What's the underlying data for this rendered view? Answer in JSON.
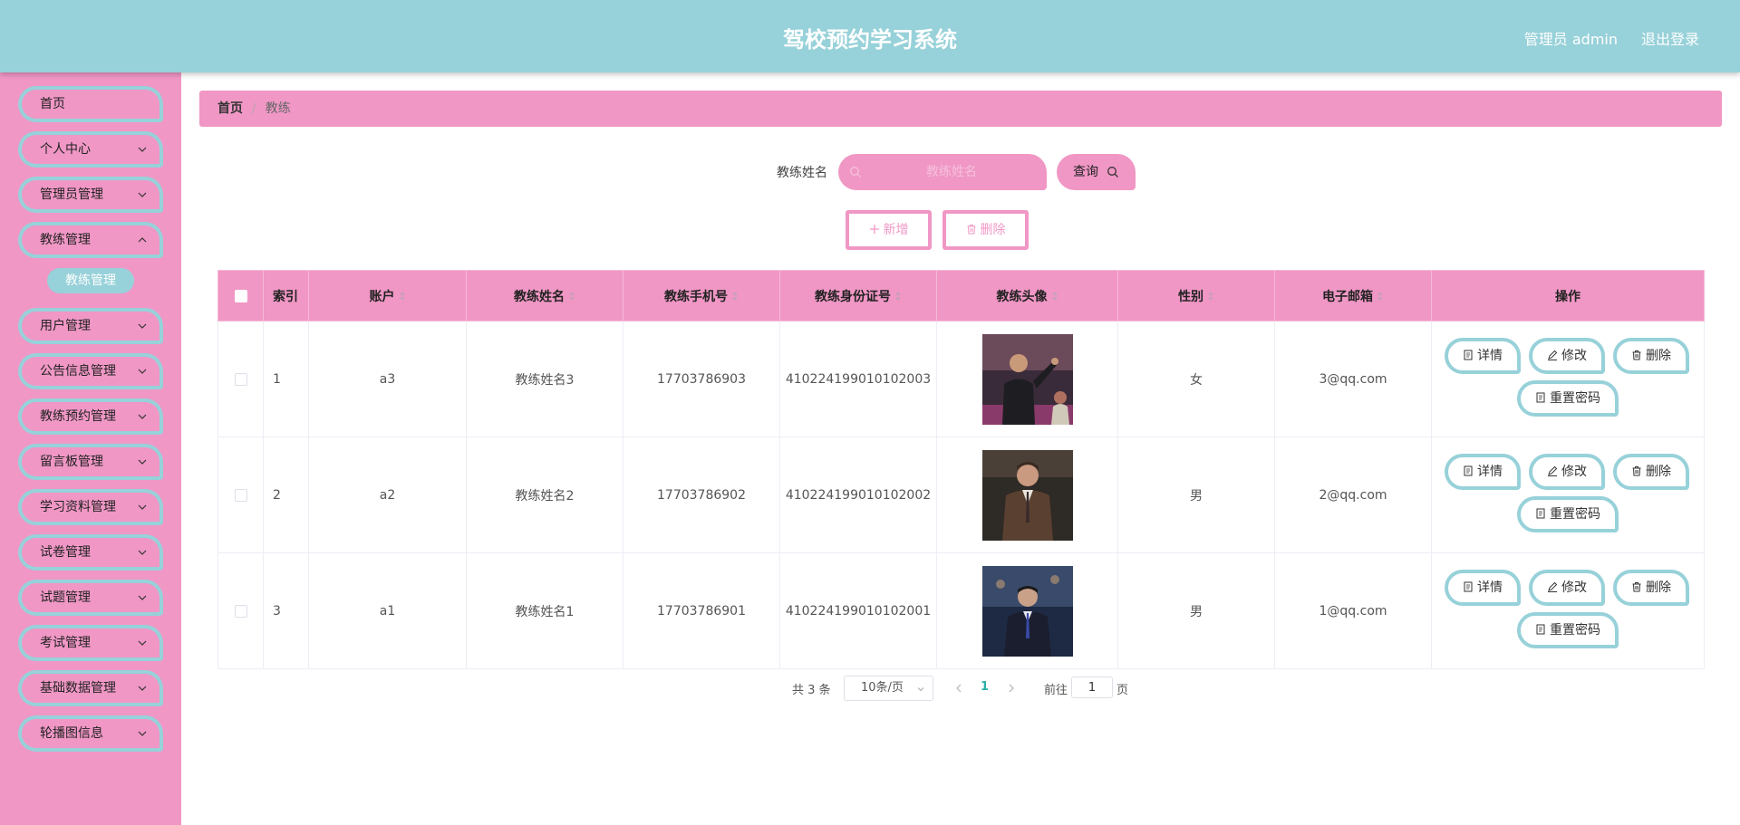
{
  "header": {
    "title": "驾校预约学习系统",
    "user": "管理员 admin",
    "logout": "退出登录"
  },
  "sidebar": {
    "items": [
      {
        "label": "首页"
      },
      {
        "label": "个人中心"
      },
      {
        "label": "管理员管理"
      },
      {
        "label": "教练管理"
      },
      {
        "label": "用户管理"
      },
      {
        "label": "公告信息管理"
      },
      {
        "label": "教练预约管理"
      },
      {
        "label": "留言板管理"
      },
      {
        "label": "学习资料管理"
      },
      {
        "label": "试卷管理"
      },
      {
        "label": "试题管理"
      },
      {
        "label": "考试管理"
      },
      {
        "label": "基础数据管理"
      },
      {
        "label": "轮播图信息"
      }
    ],
    "submenu": {
      "label": "教练管理"
    }
  },
  "breadcrumb": {
    "home": "首页",
    "sep": "/",
    "current": "教练"
  },
  "search": {
    "label": "教练姓名",
    "placeholder": "教练姓名",
    "value": "",
    "button": "查询"
  },
  "actions": {
    "add": "新增",
    "delete": "删除"
  },
  "table": {
    "headers": [
      "索引",
      "账户",
      "教练姓名",
      "教练手机号",
      "教练身份证号",
      "教练头像",
      "性别",
      "电子邮箱",
      "操作"
    ],
    "rows": [
      {
        "index": "1",
        "account": "a3",
        "name": "教练姓名3",
        "phone": "17703786903",
        "idcard": "410224199010102003",
        "gender": "女",
        "email": "3@qq.com"
      },
      {
        "index": "2",
        "account": "a2",
        "name": "教练姓名2",
        "phone": "17703786902",
        "idcard": "410224199010102002",
        "gender": "男",
        "email": "2@qq.com"
      },
      {
        "index": "3",
        "account": "a1",
        "name": "教练姓名1",
        "phone": "17703786901",
        "idcard": "410224199010102001",
        "gender": "男",
        "email": "1@qq.com"
      }
    ],
    "ops": {
      "detail": "详情",
      "edit": "修改",
      "delete": "删除",
      "reset": "重置密码"
    }
  },
  "pagination": {
    "total": "共 3 条",
    "page_size": "10条/页",
    "current": "1",
    "goto": "前往",
    "goto_value": "1",
    "page_suffix": "页"
  },
  "colors": {
    "header": "#97d1d9",
    "sidebar": "#f097c5",
    "accent": "#97d1d9",
    "page_active": "#2bb0a8"
  }
}
